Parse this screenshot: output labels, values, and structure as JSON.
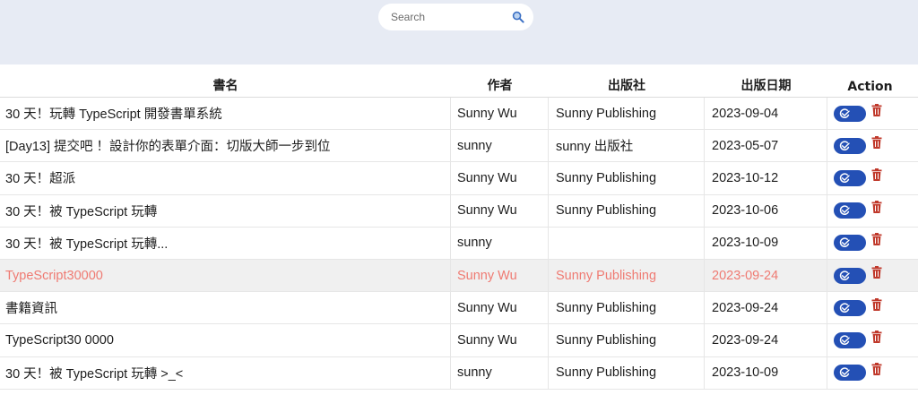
{
  "search": {
    "placeholder": "Search"
  },
  "colors": {
    "topbar_bg": "#e7ebf4",
    "edit_button": "#2450b5",
    "delete_icon": "#c0392b",
    "highlight_text": "#ef7a72",
    "highlight_row_bg": "#f0f0f0"
  },
  "table": {
    "headers": {
      "title": "書名",
      "author": "作者",
      "publisher": "出版社",
      "date": "出版日期",
      "action": "Action"
    },
    "rows": [
      {
        "title": "30 天！玩轉 TypeScript 開發書單系統",
        "author": "Sunny Wu",
        "publisher": "Sunny Publishing",
        "date": "2023-09-04"
      },
      {
        "title": "[Day13] 提交吧 ！設計你的表單介面：切版大師一步到位",
        "author": "sunny",
        "publisher": "sunny 出版社",
        "date": "2023-05-07"
      },
      {
        "title": "30 天！超派",
        "author": "Sunny Wu",
        "publisher": "Sunny Publishing",
        "date": "2023-10-12"
      },
      {
        "title": "30 天！被 TypeScript 玩轉",
        "author": "Sunny Wu",
        "publisher": "Sunny Publishing",
        "date": "2023-10-06"
      },
      {
        "title": "30 天！被 TypeScript 玩轉...",
        "author": "sunny",
        "publisher": "",
        "date": "2023-10-09"
      },
      {
        "title": "TypeScript30000",
        "author": "Sunny Wu",
        "publisher": "Sunny Publishing",
        "date": "2023-09-24"
      },
      {
        "title": "書籍資訊",
        "author": "Sunny Wu",
        "publisher": "Sunny Publishing",
        "date": "2023-09-24"
      },
      {
        "title": "TypeScript30 0000",
        "author": "Sunny Wu",
        "publisher": "Sunny Publishing",
        "date": "2023-09-24"
      },
      {
        "title": "30 天！被 TypeScript 玩轉 >_<",
        "author": "sunny",
        "publisher": "Sunny Publishing",
        "date": "2023-10-09"
      }
    ],
    "highlighted_row": 5,
    "icons": {
      "edit": "edit-icon",
      "delete": "trash-icon",
      "search": "search-icon"
    }
  }
}
